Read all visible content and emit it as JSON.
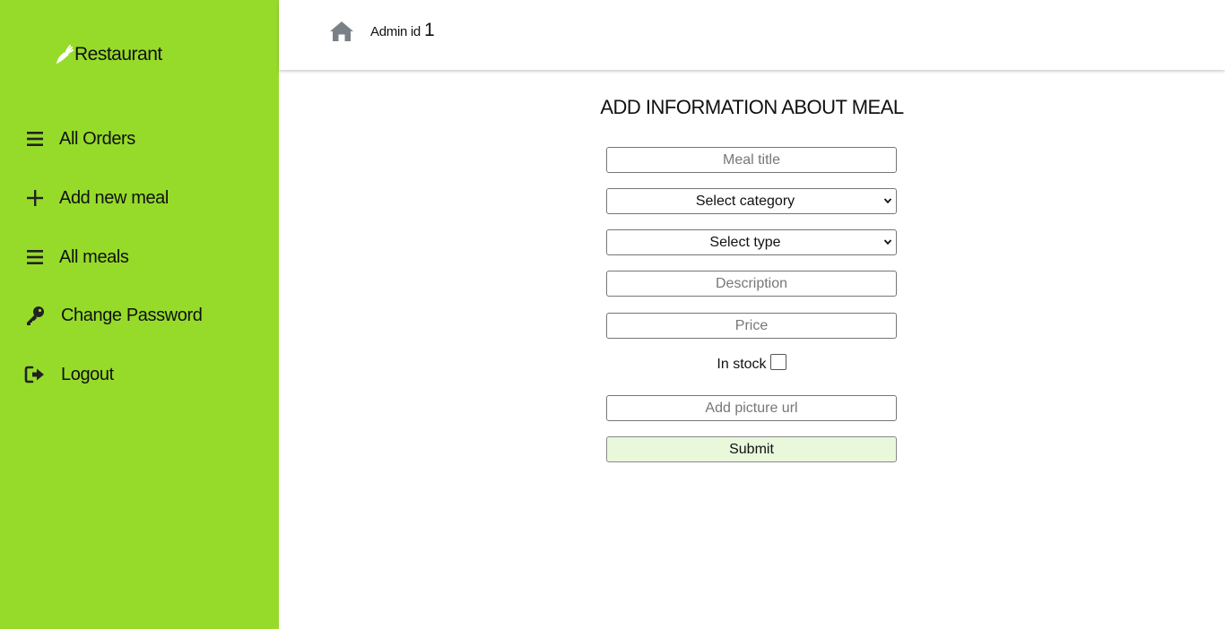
{
  "colors": {
    "sidebar_bg": "#96db2a",
    "submit_bg": "#e9f7db",
    "home_icon": "#7a8087"
  },
  "sidebar": {
    "brand": {
      "icon": "carrot-icon",
      "label": "Restaurant"
    },
    "items": [
      {
        "icon": "bars-icon",
        "label": "All Orders"
      },
      {
        "icon": "plus-icon",
        "label": "Add new meal"
      },
      {
        "icon": "bars-icon",
        "label": "All meals"
      },
      {
        "icon": "key-icon",
        "label": "Change Password"
      },
      {
        "icon": "logout-icon",
        "label": "Logout"
      }
    ]
  },
  "header": {
    "home_icon": "home-icon",
    "admin_label": "Admin id",
    "admin_id": "1"
  },
  "form": {
    "title": "ADD INFORMATION ABOUT MEAL",
    "meal_title_placeholder": "Meal title",
    "category_selected": "Select category",
    "type_selected": "Select type",
    "description_placeholder": "Description",
    "price_placeholder": "Price",
    "in_stock_label": "In stock",
    "in_stock_checked": false,
    "picture_url_placeholder": "Add picture url",
    "submit_label": "Submit"
  }
}
